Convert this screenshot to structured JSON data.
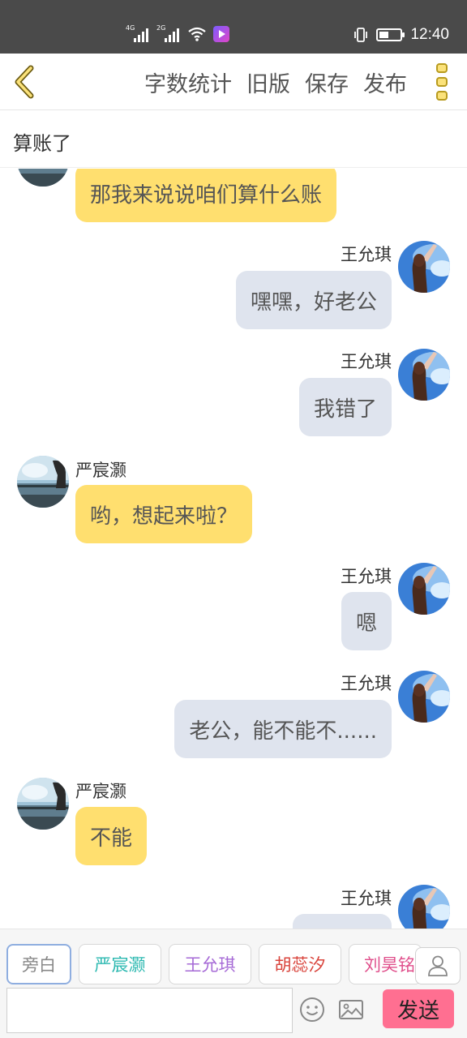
{
  "status_bar": {
    "network_1": "4G",
    "network_2": "2G",
    "battery_level": 0.45,
    "time": "12:40"
  },
  "header": {
    "actions": [
      "字数统计",
      "旧版",
      "保存",
      "发布"
    ],
    "back_icon": "chevron-left-icon",
    "more_icon": "more-vertical-icon"
  },
  "title": "算账了",
  "characters": {
    "yan": {
      "name": "严宸灏",
      "avatar": "landscape-avatar"
    },
    "wang": {
      "name": "王允琪",
      "avatar": "girl-sky-avatar"
    }
  },
  "messages": [
    {
      "speaker": "严宸灏",
      "side": "left",
      "text": "那我来说说咱们算什么账"
    },
    {
      "speaker": "王允琪",
      "side": "right",
      "text": "嘿嘿，好老公"
    },
    {
      "speaker": "王允琪",
      "side": "right",
      "text": "我错了"
    },
    {
      "speaker": "严宸灏",
      "side": "left",
      "text": "哟，想起来啦？"
    },
    {
      "speaker": "王允琪",
      "side": "right",
      "text": "嗯"
    },
    {
      "speaker": "王允琪",
      "side": "right",
      "text": "老公，能不能不......"
    },
    {
      "speaker": "严宸灏",
      "side": "left",
      "text": "不能"
    },
    {
      "speaker": "王允琪",
      "side": "right",
      "text": ""
    }
  ],
  "role_chips": [
    {
      "label": "旁白",
      "color": "#888888"
    },
    {
      "label": "严宸灏",
      "color": "#2bb8b0"
    },
    {
      "label": "王允琪",
      "color": "#a66ad6"
    },
    {
      "label": "胡蕊汐",
      "color": "#d9433b"
    },
    {
      "label": "刘昊铭",
      "color": "#e0508c"
    }
  ],
  "composer": {
    "input_value": "",
    "emoji_icon": "smiley-icon",
    "image_icon": "image-icon",
    "send_label": "发送",
    "send_color": "#ff6f91"
  },
  "colors": {
    "left_bubble": "#ffdf6f",
    "right_bubble": "#dfe4ee",
    "more_icon_fill": "#fbe27a"
  }
}
